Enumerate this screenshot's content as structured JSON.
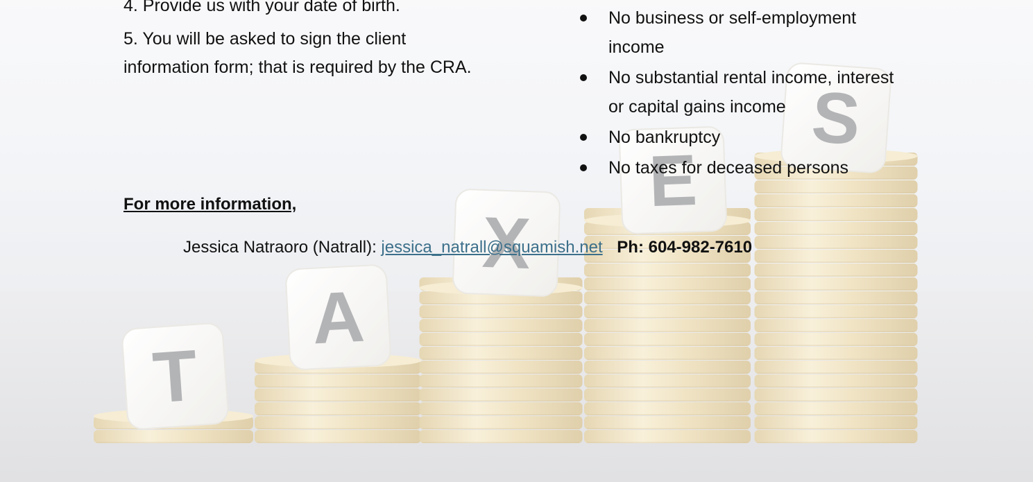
{
  "left_column": {
    "cut_line": "4. Provide us with your date of birth.",
    "step5": "5. You will be asked to sign the client information form; that is required by the CRA."
  },
  "right_column": {
    "bullets": [
      "No business or self-employment income",
      "No substantial rental income, interest or capital gains income",
      "No bankruptcy",
      "No taxes for deceased persons"
    ]
  },
  "more_info": {
    "heading": "For more information,",
    "contact_name": "Jessica Natraoro (Natrall):",
    "email": "jessica_natrall@squamish.net",
    "phone": "Ph: 604-982-7610"
  },
  "background": {
    "dice_letters": [
      "T",
      "A",
      "X",
      "E",
      "S"
    ],
    "coin_color": "#e8d6a8",
    "dice_color": "#f4f2ee",
    "letter_color": "#8b8c8f"
  }
}
